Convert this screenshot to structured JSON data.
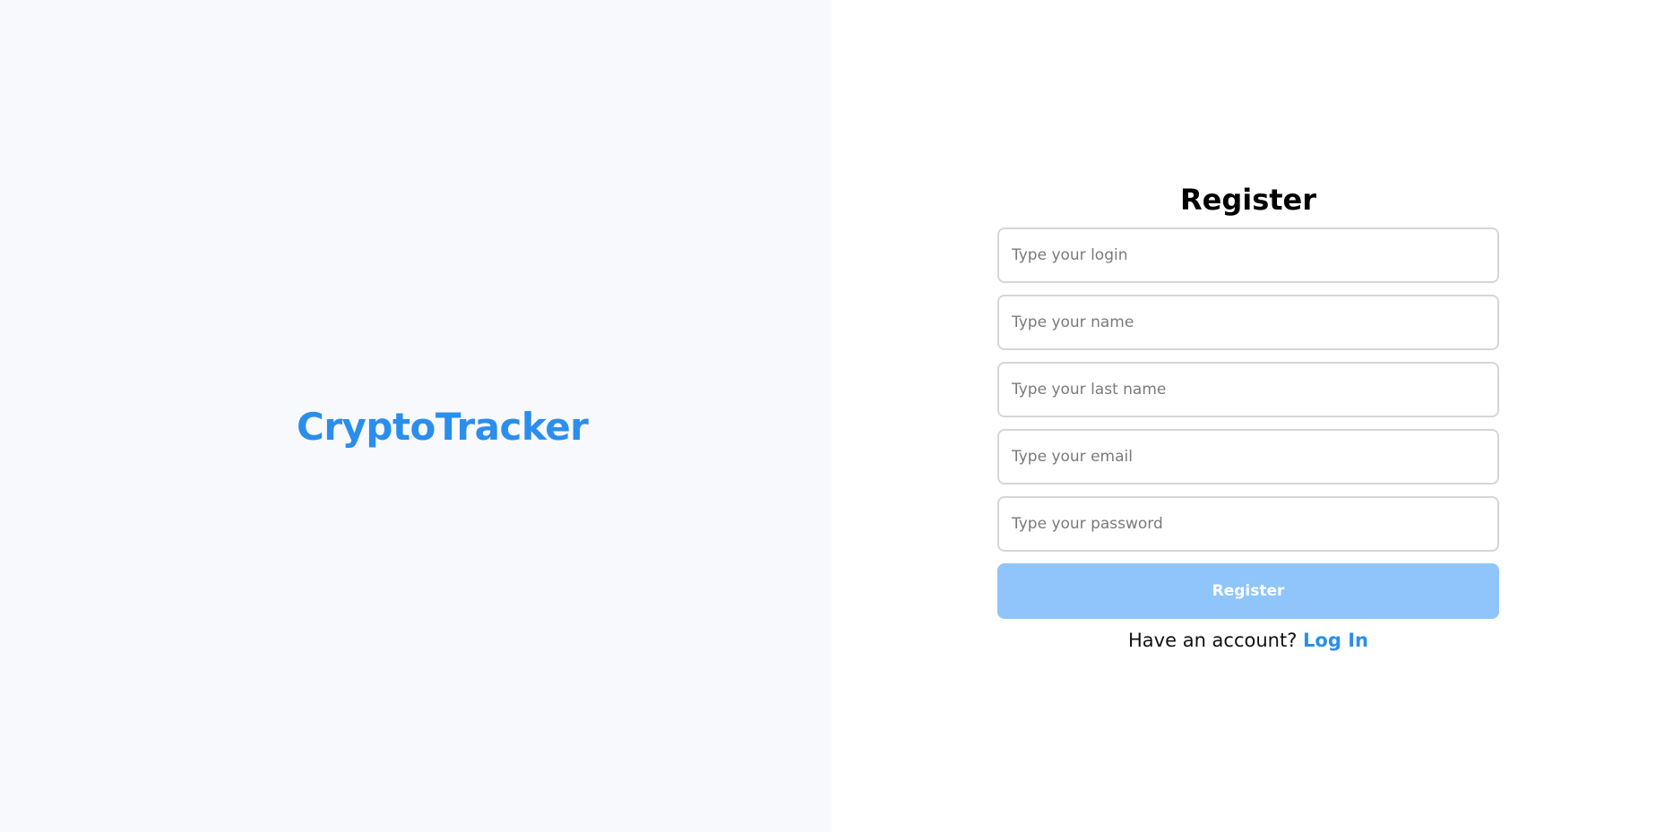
{
  "brand": {
    "logo_text": "CryptoTracker"
  },
  "register_form": {
    "title": "Register",
    "fields": {
      "login_placeholder": "Type your login",
      "name_placeholder": "Type your name",
      "last_name_placeholder": "Type your last name",
      "email_placeholder": "Type your email",
      "password_placeholder": "Type your password"
    },
    "submit_label": "Register",
    "account_prompt": "Have an account?",
    "login_link_label": "Log In"
  },
  "colors": {
    "brand_blue": "#2b8eed",
    "button_disabled_blue": "#8fc5fb",
    "left_panel_bg": "#f8f9fd",
    "input_border": "#d6d6d6"
  }
}
